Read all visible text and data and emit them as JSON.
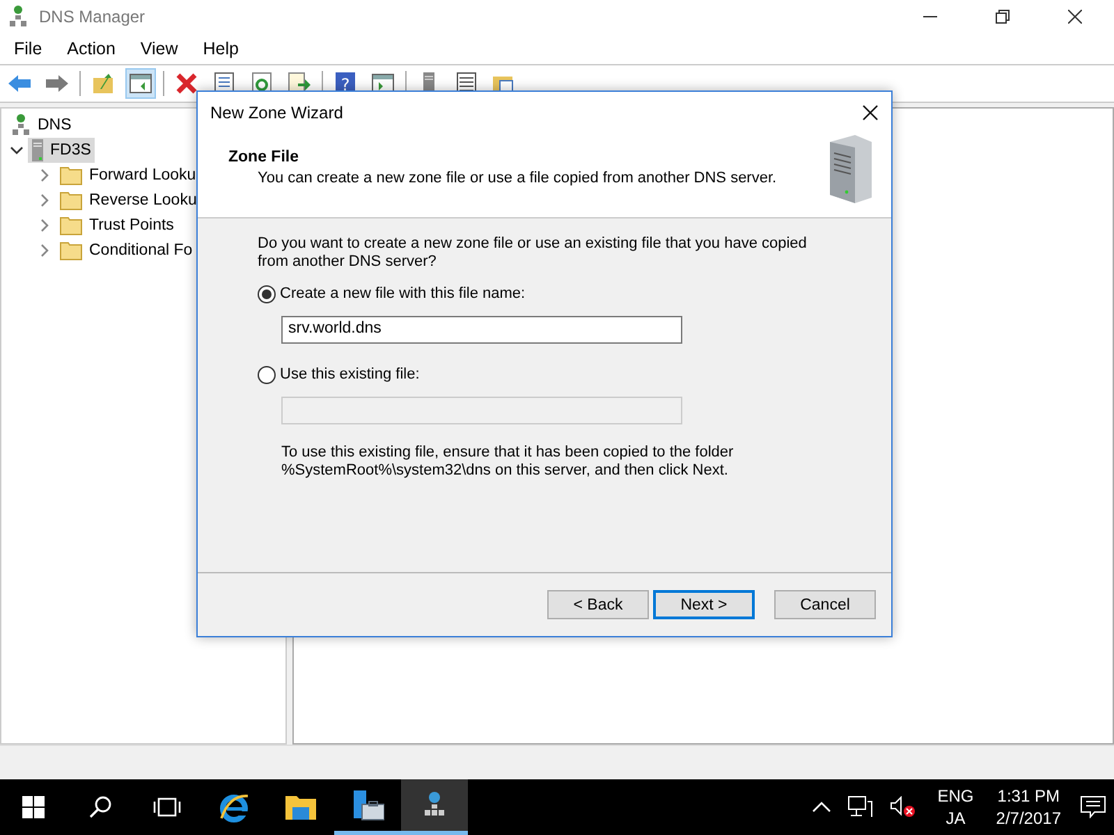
{
  "window": {
    "title": "DNS Manager"
  },
  "menu": [
    "File",
    "Action",
    "View",
    "Help"
  ],
  "toolbar": [
    {
      "kind": "back",
      "pressed": false
    },
    {
      "kind": "forward",
      "pressed": false
    },
    {
      "kind": "sep"
    },
    {
      "kind": "up",
      "pressed": false
    },
    {
      "kind": "tree",
      "pressed": true
    },
    {
      "kind": "sep"
    },
    {
      "kind": "delete",
      "pressed": false
    },
    {
      "kind": "properties",
      "pressed": false
    },
    {
      "kind": "refresh",
      "pressed": false
    },
    {
      "kind": "export",
      "pressed": false
    },
    {
      "kind": "sep"
    },
    {
      "kind": "help",
      "pressed": false,
      "glyph": "?"
    },
    {
      "kind": "pane",
      "pressed": false
    },
    {
      "kind": "sep"
    },
    {
      "kind": "server",
      "pressed": false
    },
    {
      "kind": "list",
      "pressed": false
    },
    {
      "kind": "folder",
      "pressed": false
    }
  ],
  "tree": [
    {
      "label": "DNS",
      "kind": "root",
      "selected": false,
      "children": [
        {
          "label": "FD3S",
          "kind": "server",
          "selected": true,
          "expanded": true,
          "children": [
            {
              "label": "Forward Looku",
              "kind": "folder",
              "selected": false,
              "expanded": false
            },
            {
              "label": "Reverse Looku",
              "kind": "folder",
              "selected": false,
              "expanded": false
            },
            {
              "label": "Trust Points",
              "kind": "folder",
              "selected": false,
              "expanded": false
            },
            {
              "label": "Conditional Fo",
              "kind": "folder",
              "selected": false,
              "expanded": false
            }
          ]
        }
      ]
    }
  ],
  "dialog": {
    "title": "New Zone Wizard",
    "heading": "Zone File",
    "subheading": "You can create a new zone file or use a file copied from another DNS server.",
    "question": "Do you want to create a new zone file or use an existing file that you have copied from another DNS server?",
    "options": [
      {
        "label": "Create a new file with this file name:",
        "selected": true,
        "field": {
          "value": "srv.world.dns",
          "disabled": false
        }
      },
      {
        "label": "Use this existing file:",
        "selected": false,
        "field": {
          "disabled": true
        }
      }
    ],
    "note": "To use this existing file, ensure that it has been copied to the folder %SystemRoot%\\system32\\dns on this server, and then click Next.",
    "buttons": [
      {
        "label": "< Back",
        "default": false
      },
      {
        "label": "Next >",
        "default": true
      },
      {
        "label": "Cancel",
        "default": false
      }
    ]
  },
  "taskbar": {
    "apps": [
      {
        "kind": "start",
        "running": false,
        "active": false
      },
      {
        "kind": "search",
        "running": false,
        "active": false
      },
      {
        "kind": "taskview",
        "running": false,
        "active": false
      },
      {
        "kind": "ie",
        "running": false,
        "active": false
      },
      {
        "kind": "explorer",
        "running": false,
        "active": false
      },
      {
        "kind": "servermanager",
        "running": true,
        "active": false
      },
      {
        "kind": "dns",
        "running": true,
        "active": true
      }
    ],
    "language": "ENG",
    "input": "JA",
    "time": "1:31 PM",
    "date": "2/7/2017"
  }
}
